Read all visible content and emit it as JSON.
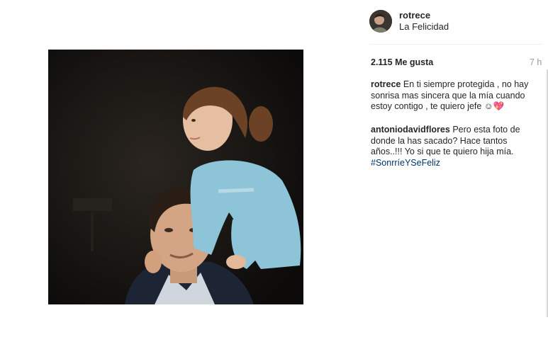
{
  "post": {
    "username": "rotrece",
    "location": "La Felicidad",
    "likes": "2.115 Me gusta",
    "time": "7 h"
  },
  "comments": [
    {
      "author": "rotrece",
      "text": "En ti siempre protegida , no hay sonrisa mas sincera que la mía cuando estoy contigo , te quiero jefe ☺💖"
    },
    {
      "author": "antoniodavidflores",
      "text": "Pero esta foto de donde la has sacado? Hace tantos años..!!! Yo si que te quiero hija mía.",
      "hashtag": "#SonrríeYSeFeliz"
    }
  ],
  "icons": {
    "avatar": "profile-avatar",
    "photo": "post-photo"
  },
  "colors": {
    "hashtag": "#003569",
    "time": "#999999",
    "divider": "#efefef"
  }
}
